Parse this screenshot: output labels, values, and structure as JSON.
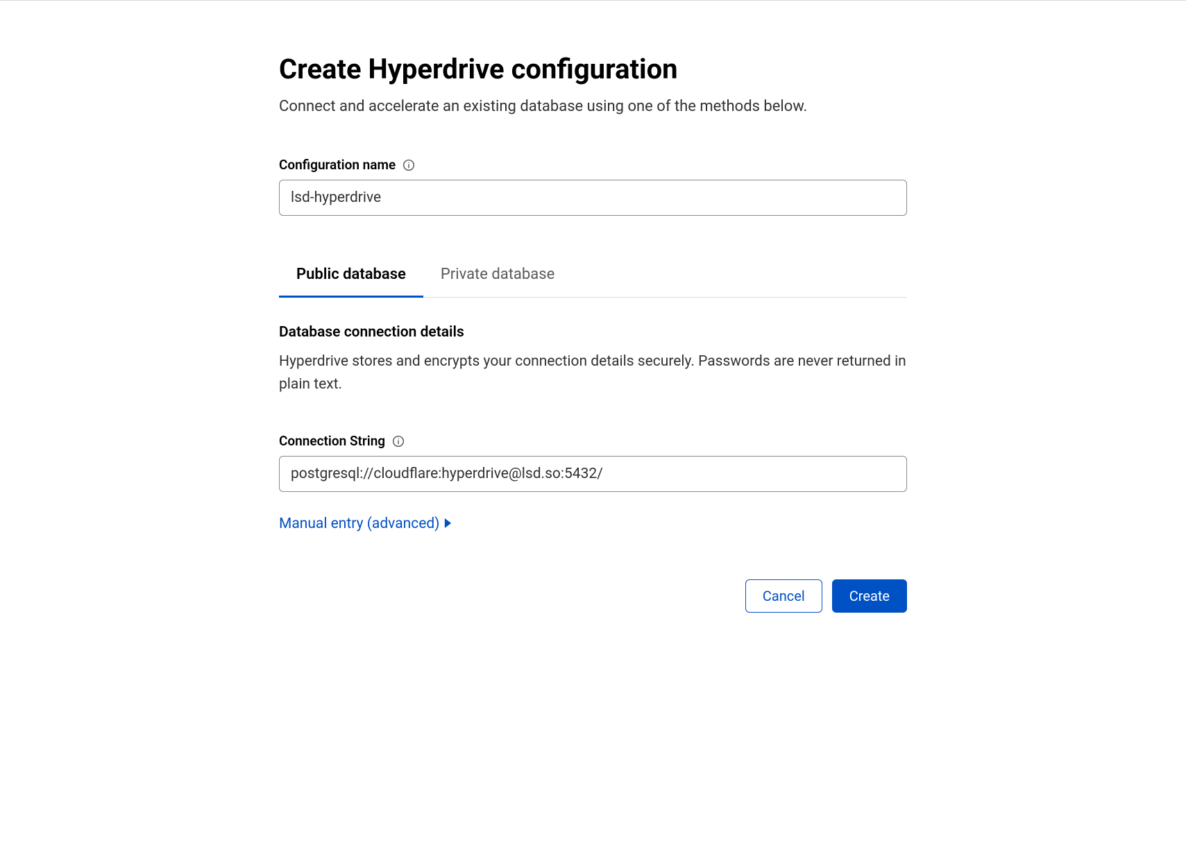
{
  "page": {
    "title": "Create Hyperdrive configuration",
    "subtitle": "Connect and accelerate an existing database using one of the methods below."
  },
  "fields": {
    "configuration_name": {
      "label": "Configuration name",
      "value": "lsd-hyperdrive"
    },
    "connection_string": {
      "label": "Connection String",
      "value": "postgresql://cloudflare:hyperdrive@lsd.so:5432/"
    }
  },
  "tabs": {
    "public": "Public database",
    "private": "Private database"
  },
  "section": {
    "title": "Database connection details",
    "description": "Hyperdrive stores and encrypts your connection details securely. Passwords are never returned in plain text."
  },
  "links": {
    "manual_entry": "Manual entry (advanced)"
  },
  "buttons": {
    "cancel": "Cancel",
    "create": "Create"
  }
}
